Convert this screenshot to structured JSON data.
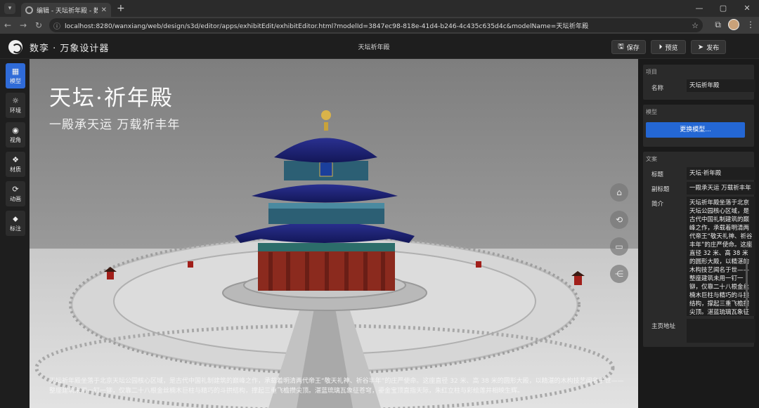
{
  "browser": {
    "tab_title": "编辑 - 天坛祈年殿 - 数孪万象",
    "url": "localhost:8280/wanxiang/web/design/s3d/editor/apps/exhibitEdit/exhibitEditor.html?modelId=3847ec98-818e-41d4-b246-4c435c635d4c&modelName=天坛祈年殿"
  },
  "app": {
    "brand": "数孪 · 万象设计器",
    "doc_title": "天坛祈年殿",
    "buttons": {
      "save": "保存",
      "preview": "预览",
      "publish": "发布"
    }
  },
  "toolbar": [
    {
      "label": "模型",
      "icon": "grid-icon"
    },
    {
      "label": "环境",
      "icon": "environment-icon"
    },
    {
      "label": "视角",
      "icon": "camera-icon"
    },
    {
      "label": "材质",
      "icon": "material-icon"
    },
    {
      "label": "动画",
      "icon": "animation-icon"
    },
    {
      "label": "标注",
      "icon": "tag-icon"
    }
  ],
  "viewport": {
    "headline": "天坛·祈年殿",
    "subline": "一殿承天运 万载祈丰年",
    "caption": "天坛祈年殿坐落于北京天坛公园核心区域，是古代中国礼制建筑的巅峰之作，承载着明清两代帝王“敬天礼神、祈谷丰年”的庄严使命。这座直径 32 米、高 38 米的圆形大殿，以精湛的木构技艺闻名于世——整座建筑未用一钉一铆，仅靠二十八根金丝楠木巨柱与精巧的斗拱结构，撑起三重飞檐攒尖顶。湛蓝琉璃瓦象征苍穹，鎏金宝顶直指天际，朱红立柱与彩绘莲井相映生辉。"
  },
  "panel": {
    "project": {
      "title": "项目",
      "name_label": "名称",
      "name_value": "天坛祈年殿"
    },
    "model": {
      "title": "模型",
      "replace_label": "更换模型..."
    },
    "copy": {
      "title": "文案",
      "title_label": "标题",
      "title_value": "天坛·祈年殿",
      "subtitle_label": "副标题",
      "subtitle_value": "一殿承天运 万载祈丰年",
      "intro_label": "简介",
      "intro_value": "天坛祈年殿坐落于北京天坛公园核心区域，是古代中国礼制建筑的巅峰之作，承载着明清两代帝王“敬天礼神、祈谷丰年”的庄严使命。这座直径 32 米、高 38 米的圆形大殿，以精湛的木构技艺闻名于世——整座建筑未用一钉一铆，仅靠二十八根金丝楠木巨柱与精巧的斗拱结构，撑起三重飞檐攒尖顶。湛蓝琉璃瓦象征苍穹，鎏金宝顶直指天际，朱红立柱与彩绘莲井相映生辉。",
      "homepage_label": "主页地址",
      "homepage_value": ""
    }
  },
  "colors": {
    "accent": "#2467d4",
    "roof": "#1a1f6e",
    "pillar": "#8b2a1e"
  }
}
